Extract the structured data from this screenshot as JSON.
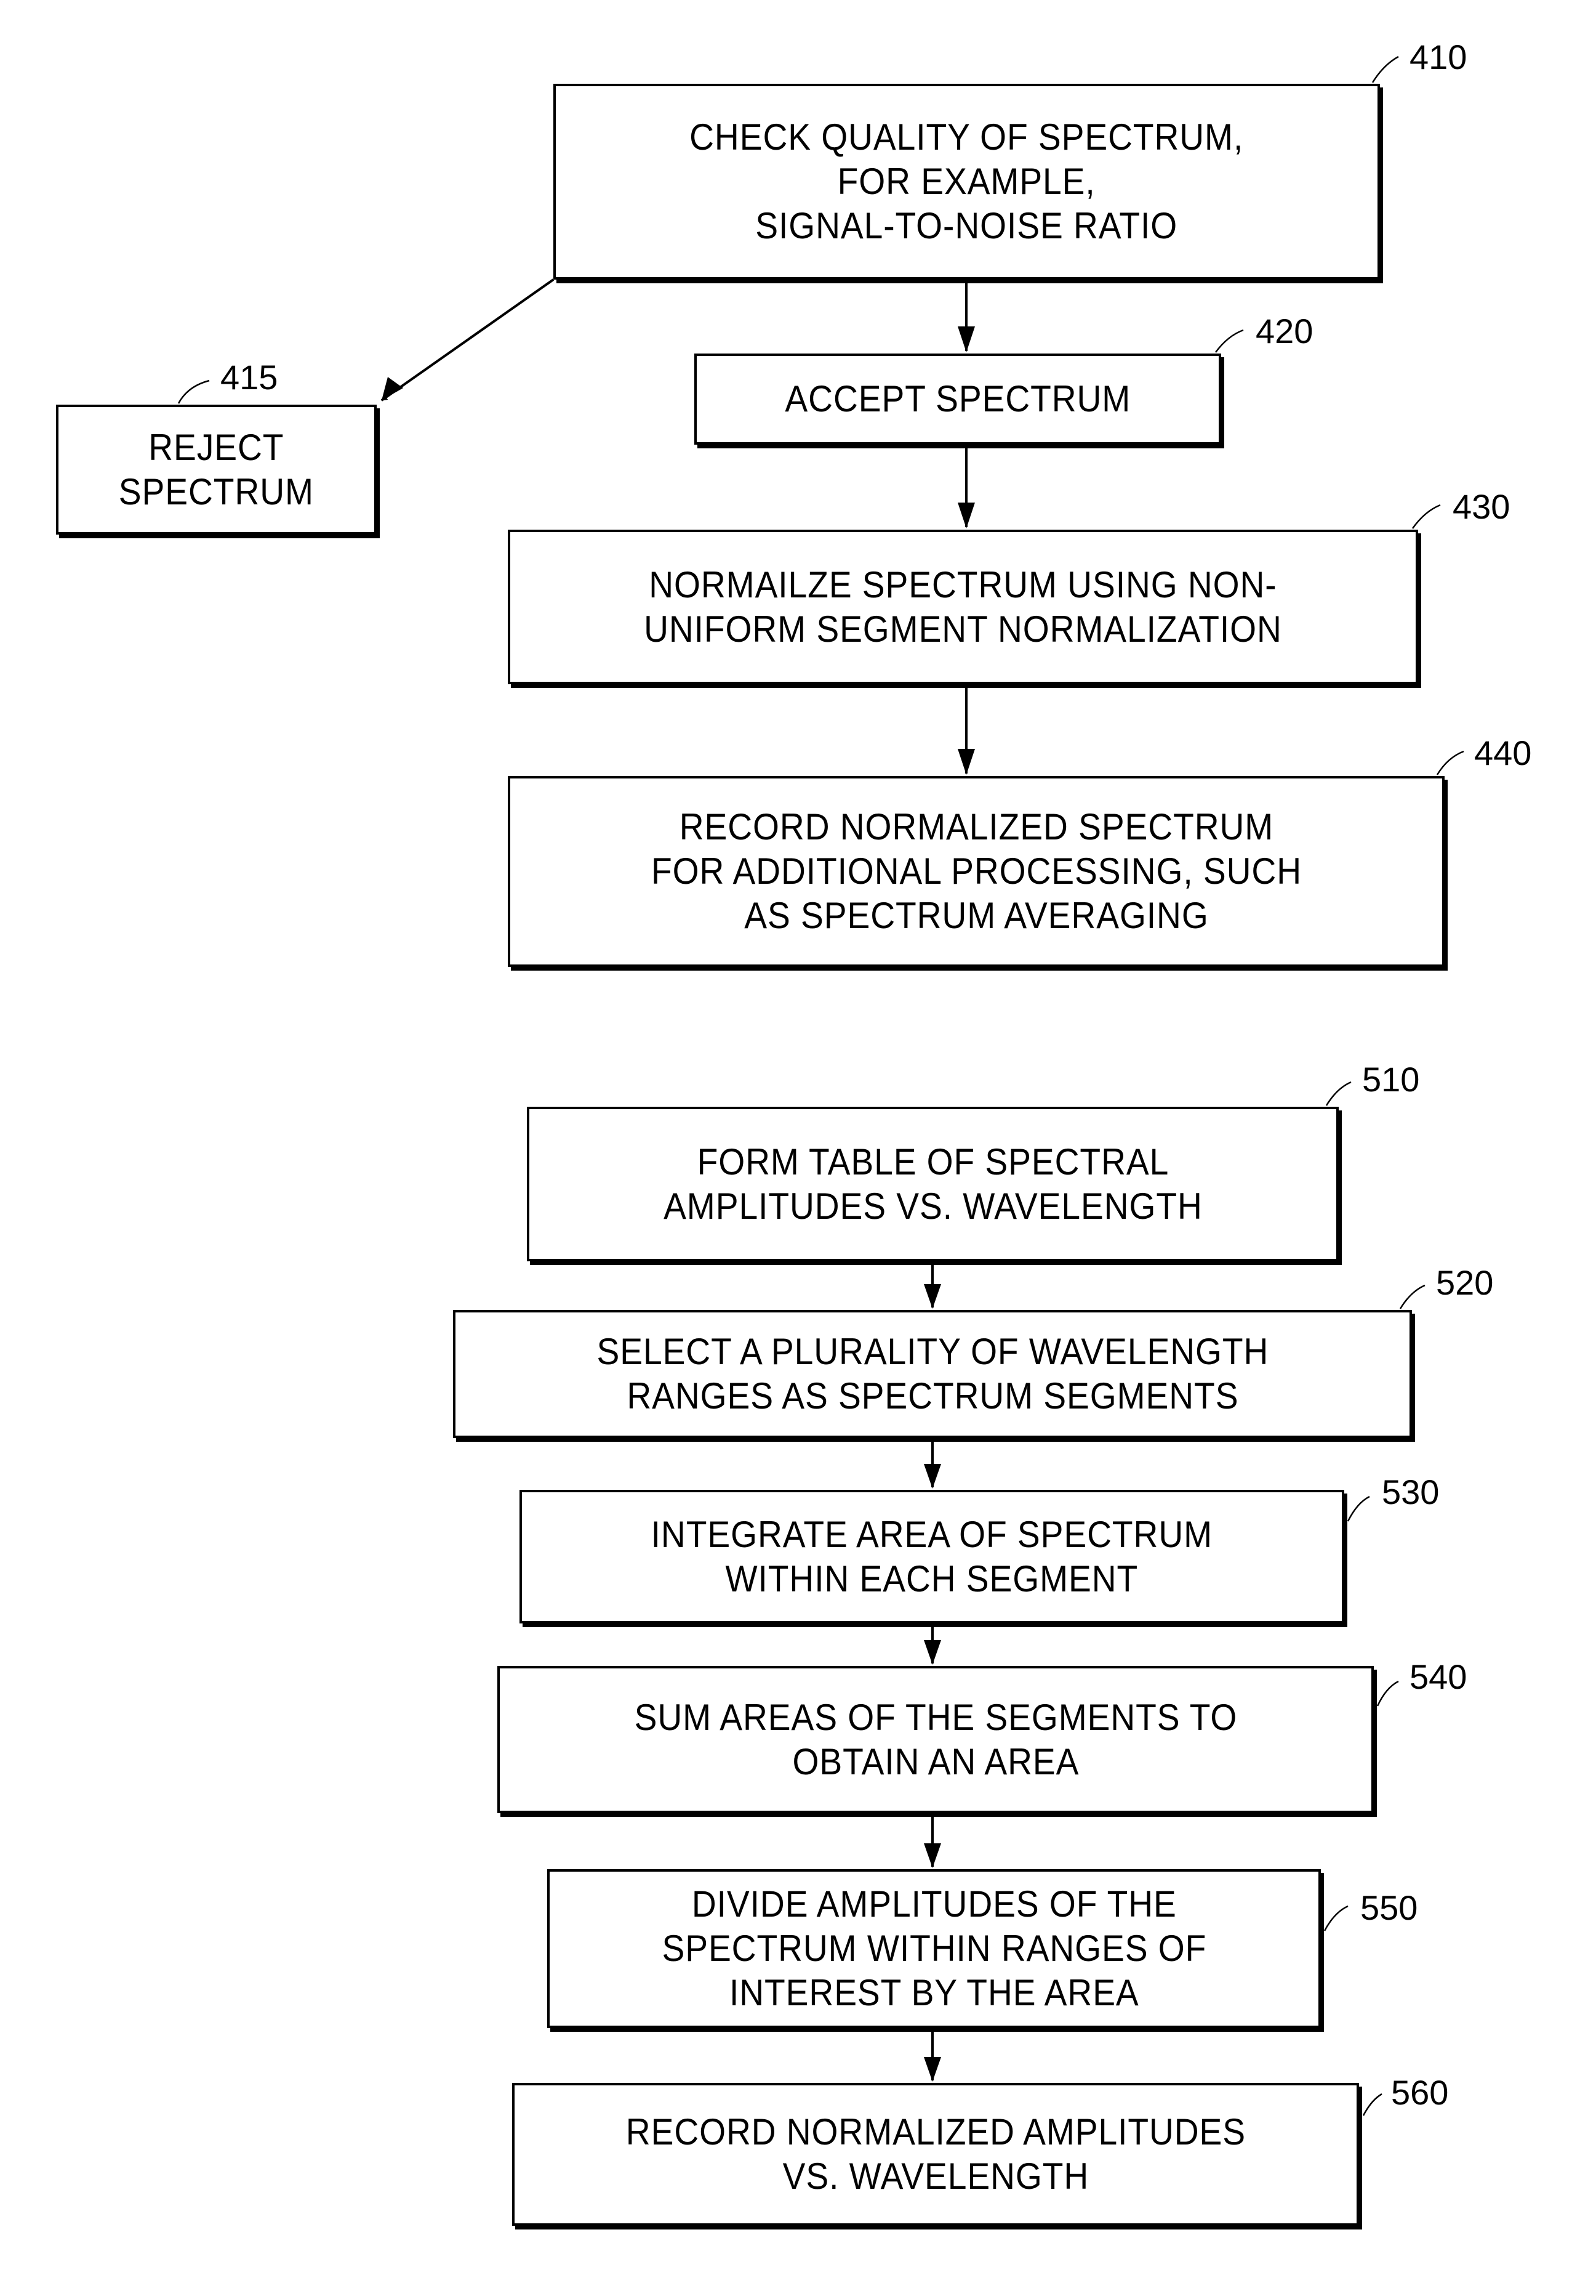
{
  "figure": {
    "flow_a": [
      {
        "ref": "410",
        "text": "CHECK QUALITY OF SPECTRUM,\nFOR EXAMPLE,\nSIGNAL-TO-NOISE RATIO"
      },
      {
        "ref": "415",
        "text": "REJECT\nSPECTRUM"
      },
      {
        "ref": "420",
        "text": "ACCEPT SPECTRUM"
      },
      {
        "ref": "430",
        "text": "NORMAILZE SPECTRUM USING NON-\nUNIFORM SEGMENT NORMALIZATION"
      },
      {
        "ref": "440",
        "text": "RECORD NORMALIZED SPECTRUM\nFOR ADDITIONAL PROCESSING, SUCH\nAS SPECTRUM AVERAGING"
      }
    ],
    "flow_b": [
      {
        "ref": "510",
        "text": "FORM TABLE OF SPECTRAL\nAMPLITUDES VS. WAVELENGTH"
      },
      {
        "ref": "520",
        "text": "SELECT A PLURALITY OF WAVELENGTH\nRANGES AS SPECTRUM SEGMENTS"
      },
      {
        "ref": "530",
        "text": "INTEGRATE AREA OF SPECTRUM\nWITHIN EACH SEGMENT"
      },
      {
        "ref": "540",
        "text": "SUM AREAS OF THE SEGMENTS TO\nOBTAIN AN AREA"
      },
      {
        "ref": "550",
        "text": "DIVIDE AMPLITUDES OF THE\nSPECTRUM WITHIN RANGES OF\nINTEREST BY THE AREA"
      },
      {
        "ref": "560",
        "text": "RECORD NORMALIZED AMPLITUDES\nVS. WAVELENGTH"
      }
    ]
  }
}
